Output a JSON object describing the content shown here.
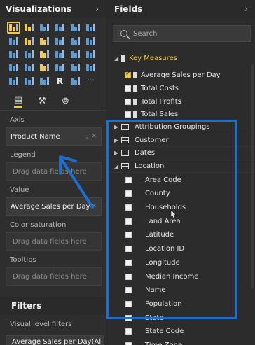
{
  "viz": {
    "title": "Visualizations",
    "collapse_glyph": "›",
    "icons": [
      {
        "name": "stacked-bar-icon",
        "color": "#f2c94c"
      },
      {
        "name": "stacked-column-icon",
        "color": "#f2c94c"
      },
      {
        "name": "clustered-bar-icon",
        "color": "#5b9bd5"
      },
      {
        "name": "clustered-column-icon",
        "color": "#5b9bd5"
      },
      {
        "name": "100pct-bar-icon",
        "color": "#5b9bd5"
      },
      {
        "name": "100pct-column-icon",
        "color": "#5b9bd5"
      },
      {
        "name": "line-chart-icon",
        "color": "#5b9bd5"
      },
      {
        "name": "area-chart-icon",
        "color": "#f2c94c"
      },
      {
        "name": "stacked-area-icon",
        "color": "#f2c94c"
      },
      {
        "name": "line-column-icon",
        "color": "#5b9bd5"
      },
      {
        "name": "line-stacked-column-icon",
        "color": "#5b9bd5"
      },
      {
        "name": "ribbon-chart-icon",
        "color": "#5b9bd5"
      },
      {
        "name": "waterfall-icon",
        "color": "#5b9bd5"
      },
      {
        "name": "scatter-icon",
        "color": "#5b9bd5"
      },
      {
        "name": "pie-chart-icon",
        "color": "#f2c94c"
      },
      {
        "name": "donut-chart-icon",
        "color": "#5b9bd5"
      },
      {
        "name": "treemap-icon",
        "color": "#5b9bd5"
      },
      {
        "name": "map-icon",
        "color": "#5b9bd5"
      },
      {
        "name": "filled-map-icon",
        "color": "#5b9bd5"
      },
      {
        "name": "funnel-icon",
        "color": "#5b9bd5"
      },
      {
        "name": "gauge-icon",
        "color": "#f2c94c"
      },
      {
        "name": "card-icon",
        "color": "#5b9bd5"
      },
      {
        "name": "multi-row-card-icon",
        "color": "#5b9bd5"
      },
      {
        "name": "kpi-icon",
        "color": "#5b9bd5"
      },
      {
        "name": "slicer-icon",
        "color": "#5b9bd5"
      },
      {
        "name": "table-icon",
        "color": "#5b9bd5"
      },
      {
        "name": "matrix-icon",
        "color": "#5b9bd5"
      },
      {
        "name": "r-visual-icon",
        "color": "#5b9bd5"
      },
      {
        "name": "globe-icon",
        "color": "#5b9bd5"
      },
      {
        "name": "more-icon",
        "color": "#cccccc"
      }
    ],
    "r_label": "R",
    "more_label": "···",
    "wells": {
      "axis_label": "Axis",
      "axis_value": "Product Name",
      "legend_label": "Legend",
      "legend_placeholder": "Drag data fields here",
      "value_label": "Value",
      "value_value": "Average Sales per Day",
      "color_sat_label": "Color saturation",
      "color_sat_placeholder": "Drag data fields here",
      "tooltips_label": "Tooltips",
      "tooltips_placeholder": "Drag data fields here"
    },
    "filters_title": "Filters",
    "visual_level_label": "Visual level filters",
    "visual_level_item": "Average Sales per Day(All)"
  },
  "fields": {
    "title": "Fields",
    "collapse_glyph": "›",
    "search_placeholder": "Search",
    "measures_group": "Key Measures",
    "measures": [
      {
        "label": "Average Sales per Day",
        "checked": true
      },
      {
        "label": "Total Costs",
        "checked": false
      },
      {
        "label": "Total Profits",
        "checked": false
      },
      {
        "label": "Total Sales",
        "checked": false
      }
    ],
    "groups": [
      {
        "label": "Attribution Groupings"
      },
      {
        "label": "Customer"
      },
      {
        "label": "Dates"
      },
      {
        "label": "Location"
      }
    ],
    "location_fields": [
      "Area Code",
      "County",
      "Households",
      "Land Area",
      "Latitude",
      "Location ID",
      "Longitude",
      "Median Income",
      "Name",
      "Population",
      "State",
      "State Code",
      "Time Zone"
    ]
  },
  "colors": {
    "accent": "#f2c94c",
    "highlight_box": "#1c6fd1",
    "arrow": "#1c6fd1"
  }
}
